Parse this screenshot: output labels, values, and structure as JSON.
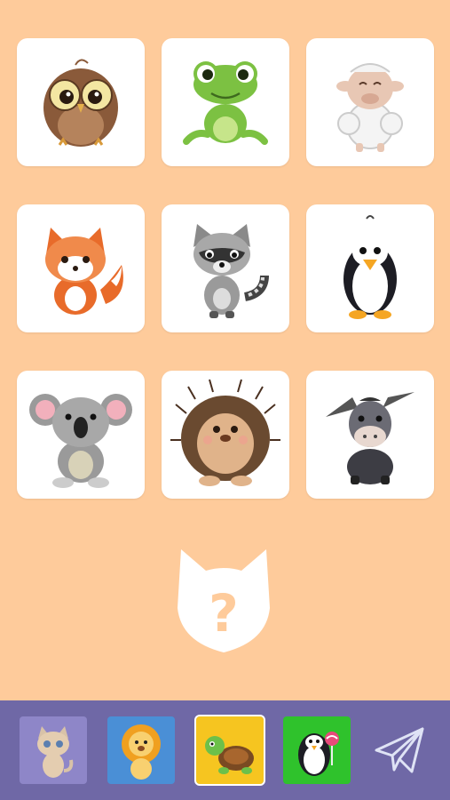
{
  "game": {
    "cards": [
      {
        "animal": "owl",
        "icon": "owl-icon"
      },
      {
        "animal": "frog",
        "icon": "frog-icon"
      },
      {
        "animal": "sheep",
        "icon": "sheep-icon"
      },
      {
        "animal": "fox",
        "icon": "fox-icon"
      },
      {
        "animal": "raccoon",
        "icon": "raccoon-icon"
      },
      {
        "animal": "penguin",
        "icon": "penguin-icon"
      },
      {
        "animal": "koala",
        "icon": "koala-icon"
      },
      {
        "animal": "hedgehog",
        "icon": "hedgehog-icon"
      },
      {
        "animal": "donkey",
        "icon": "donkey-icon"
      }
    ],
    "mystery": {
      "symbol": "?",
      "icon": "cat-head-question-icon"
    },
    "tray": [
      {
        "animal": "cat",
        "icon": "cat-icon",
        "bg": "#8e86c8",
        "selected": false
      },
      {
        "animal": "lion",
        "icon": "lion-icon",
        "bg": "#4a8fd6",
        "selected": false
      },
      {
        "animal": "turtle",
        "icon": "turtle-icon",
        "bg": "#f6c520",
        "selected": true
      },
      {
        "animal": "penguin",
        "icon": "penguin-lollipop-icon",
        "bg": "#2fc22c",
        "selected": false
      }
    ],
    "send_icon": "paper-plane-icon"
  },
  "colors": {
    "background": "#fecb9b",
    "card": "#ffffff",
    "bottom_bar": "#6f68a6",
    "mystery_fill": "#ffffff"
  }
}
